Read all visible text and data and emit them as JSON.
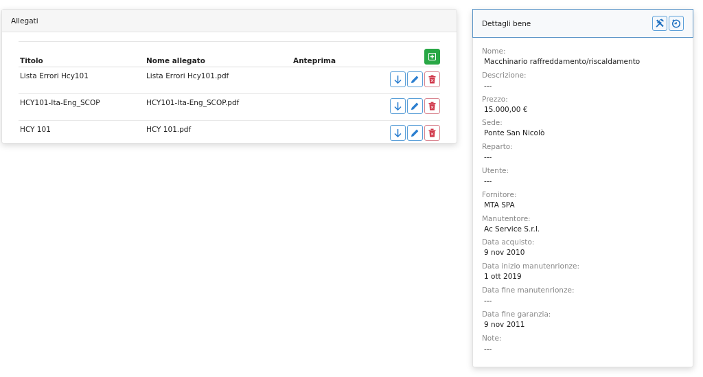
{
  "attachments": {
    "title": "Allegati",
    "columns": [
      "Titolo",
      "Nome allegato",
      "Anteprima"
    ],
    "rows": [
      {
        "title": "Lista Errori Hcy101",
        "file": "Lista Errori Hcy101.pdf"
      },
      {
        "title": "HCY101-Ita-Eng_SCOP",
        "file": "HCY101-Ita-Eng_SCOP.pdf"
      },
      {
        "title": "HCY 101",
        "file": "HCY 101.pdf"
      }
    ]
  },
  "details": {
    "title": "Dettagli bene",
    "fields": [
      {
        "label": "Nome:",
        "value": "Macchinario raffreddamento/riscaldamento"
      },
      {
        "label": "Descrizione:",
        "value": "---"
      },
      {
        "label": "Prezzo:",
        "value": "15.000,00 €"
      },
      {
        "label": "Sede:",
        "value": "Ponte San Nicolò"
      },
      {
        "label": "Reparto:",
        "value": "---"
      },
      {
        "label": "Utente:",
        "value": "---"
      },
      {
        "label": "Fornitore:",
        "value": "MTA SPA"
      },
      {
        "label": "Manutentore:",
        "value": "Ac Service S.r.l."
      },
      {
        "label": "Data acquisto:",
        "value": "9 nov 2010"
      },
      {
        "label": "Data inizio manutenrionze:",
        "value": "1 ott 2019"
      },
      {
        "label": "Data fine manutenrionze:",
        "value": "---"
      },
      {
        "label": "Data fine garanzia:",
        "value": "9 nov 2011"
      },
      {
        "label": "Note:",
        "value": "---"
      }
    ]
  }
}
